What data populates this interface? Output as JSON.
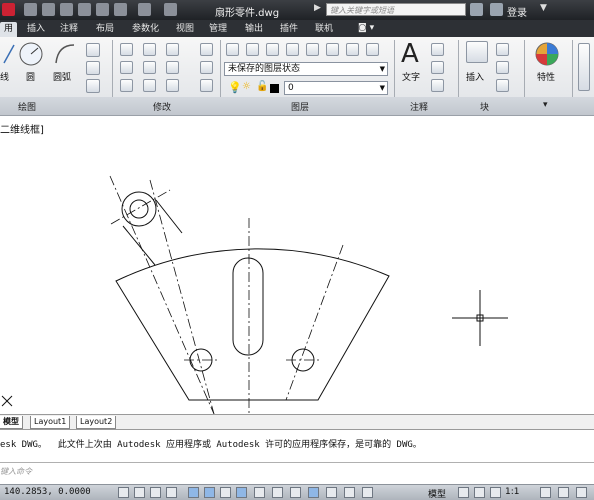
{
  "titlebar": {
    "title": "扇形零件.dwg",
    "search_placeholder": "键入关键字或短语",
    "login": "登录"
  },
  "ribbon_tabs": [
    "用",
    "插入",
    "注释",
    "布局",
    "参数化",
    "视图",
    "管理",
    "输出",
    "插件",
    "联机"
  ],
  "ribbon": {
    "draw": {
      "line": "线",
      "circle": "圆",
      "arc": "圆弧",
      "panel": "绘图"
    },
    "modify": {
      "panel": "修改"
    },
    "layers": {
      "state": "未保存的图层状态",
      "current": "0",
      "panel": "图层"
    },
    "annotation": {
      "text": "文字",
      "panel": "注释"
    },
    "block": {
      "insert": "插入",
      "panel": "块"
    },
    "properties": {
      "label": "特性"
    }
  },
  "viewport": {
    "label": "二维线框]"
  },
  "layout_tabs": [
    "模型",
    "Layout1",
    "Layout2"
  ],
  "command": {
    "history": "esk DWG。  此文件上次由 Autodesk 应用程序或 Autodesk 许可的应用程序保存，是可靠的 DWG。",
    "placeholder": "键入命令"
  },
  "statusbar": {
    "coords": "140.2853, 0.0000",
    "model": "模型",
    "scale": "1:1"
  },
  "colors": {
    "titlebar": "#2a2d31",
    "ribbon": "#e4e7eb",
    "active_toggle": "#8fb7e6"
  }
}
